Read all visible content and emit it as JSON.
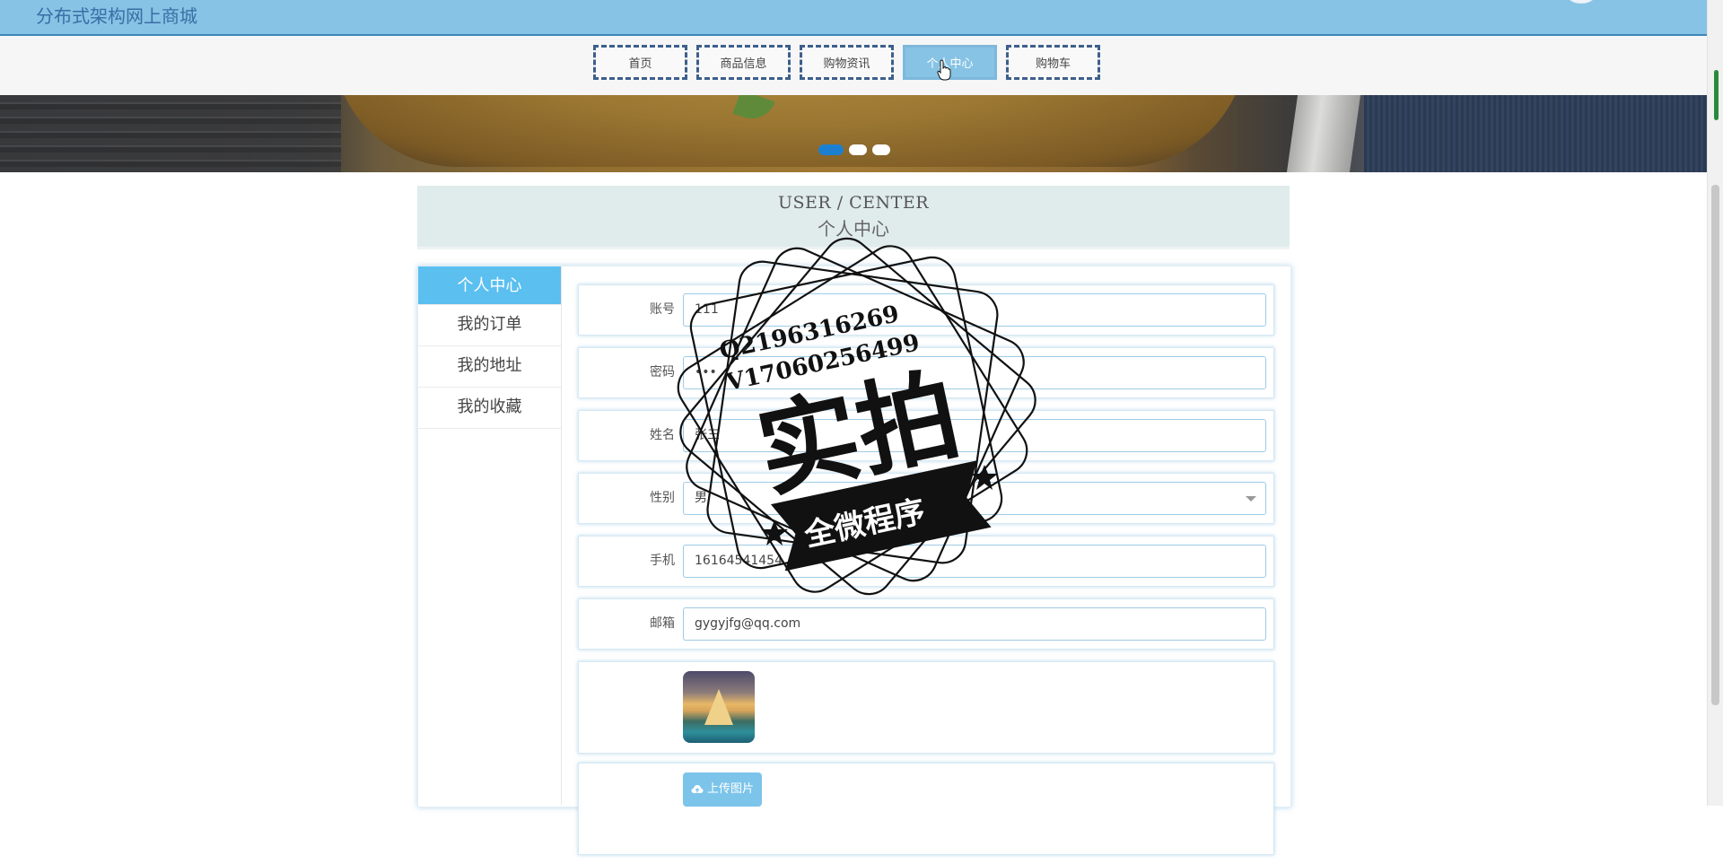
{
  "header": {
    "site_title": "分布式架构网上商城"
  },
  "nav": {
    "items": [
      {
        "label": "首页",
        "active": false
      },
      {
        "label": "商品信息",
        "active": false
      },
      {
        "label": "购物资讯",
        "active": false
      },
      {
        "label": "个人中心",
        "active": true
      },
      {
        "label": "购物车",
        "active": false
      }
    ]
  },
  "banner": {
    "slides": 3,
    "active_slide": 1
  },
  "section": {
    "title_en": "USER / CENTER",
    "title_cn": "个人中心"
  },
  "sidebar": {
    "items": [
      {
        "label": "个人中心",
        "active": true
      },
      {
        "label": "我的订单",
        "active": false
      },
      {
        "label": "我的地址",
        "active": false
      },
      {
        "label": "我的收藏",
        "active": false
      }
    ]
  },
  "form": {
    "account": {
      "label": "账号",
      "value": "111"
    },
    "password": {
      "label": "密码",
      "value": "•••"
    },
    "name": {
      "label": "姓名",
      "value": "张三"
    },
    "gender": {
      "label": "性别",
      "value": "男"
    },
    "phone": {
      "label": "手机",
      "value": "16164541454"
    },
    "email": {
      "label": "邮箱",
      "value": "gygyjfg@qq.com"
    },
    "upload_label": "上传图片"
  },
  "watermark": {
    "line1": "Q2196316269",
    "line2": "V17060256499",
    "main": "实拍",
    "ribbon": "全微程序"
  },
  "colors": {
    "header_bg": "#86c3e5",
    "nav_active": "#86c3e5",
    "nav_border": "#3d5f8c",
    "sidebar_active": "#5bbff0",
    "upload_button": "#7cc4ea",
    "carousel_dot_active": "#1d7fd0"
  },
  "icons": {
    "cursor": "hand-pointer-icon",
    "upload": "cloud-upload-icon",
    "select_caret": "caret-down-icon"
  }
}
